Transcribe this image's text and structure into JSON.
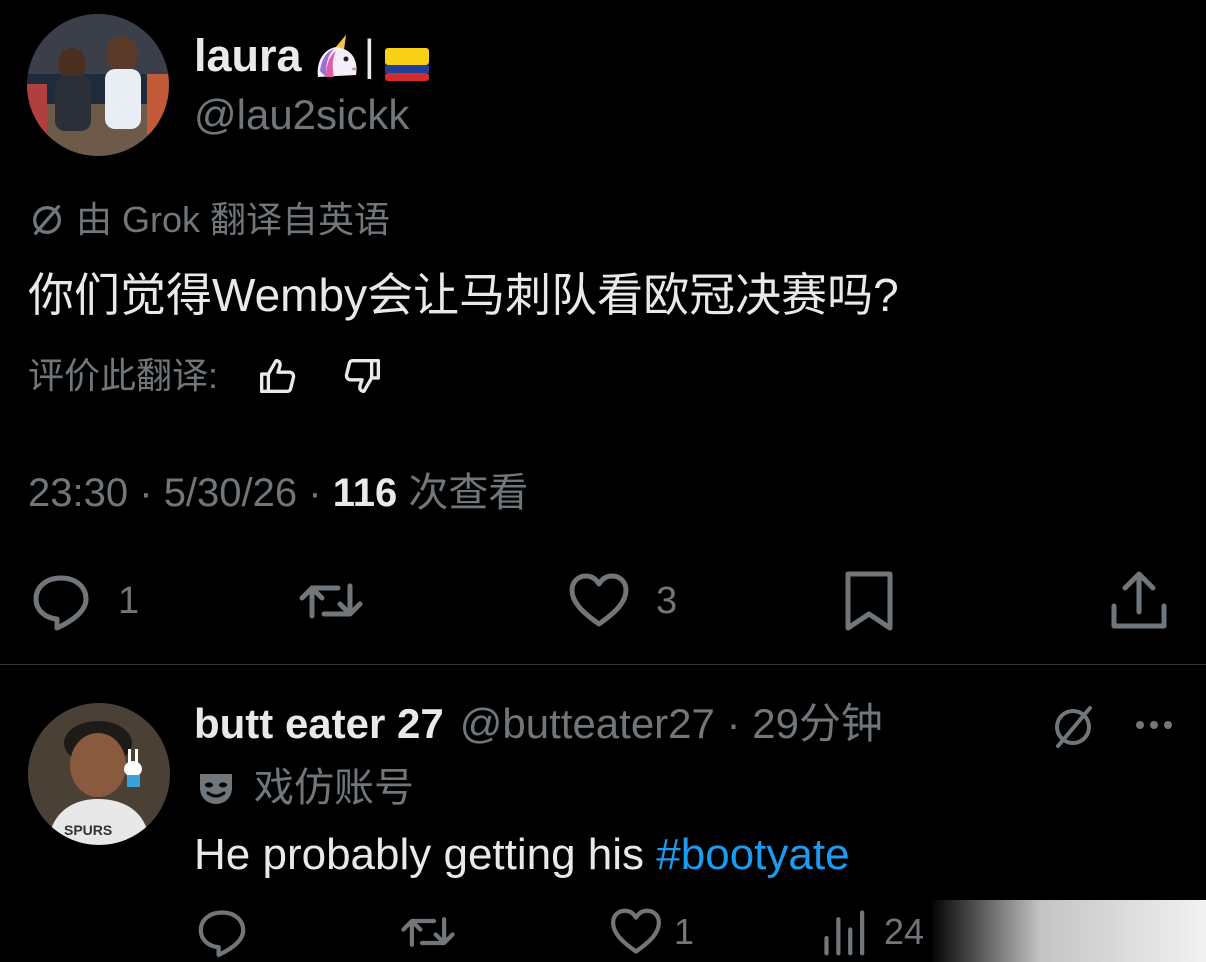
{
  "main_tweet": {
    "display_name": "laura",
    "name_separator": "|",
    "handle": "@lau2sickk",
    "translated_by_label": "由 Grok 翻译自英语",
    "text": "你们觉得Wemby会让马刺队看欧冠决赛吗?",
    "rate_translation_label": "评价此翻译:",
    "time": "23:30",
    "date": "5/30/26",
    "dot_separator": "·",
    "views_count": "116",
    "views_label": "次查看",
    "actions": {
      "reply_count": "1",
      "like_count": "3"
    },
    "icons": [
      "verified-translation-icon",
      "thumbs-up-icon",
      "thumbs-down-icon",
      "reply-icon",
      "retweet-icon",
      "like-icon",
      "bookmark-icon",
      "share-icon",
      "unicorn-emoji",
      "colombia-flag-emoji"
    ]
  },
  "reply": {
    "display_name": "butt eater 27",
    "handle_time": "@butteater27 · 29分钟",
    "parody_label": "戏仿账号",
    "text_prefix": "He probably getting his ",
    "hashtag": "#bootyate",
    "actions": {
      "like_count": "1",
      "views_count": "24"
    }
  },
  "colors": {
    "background": "#000000",
    "primary_text": "#e7e9ea",
    "secondary_text": "#71767b",
    "link": "#1d9bf0",
    "divider": "#2f3336"
  }
}
